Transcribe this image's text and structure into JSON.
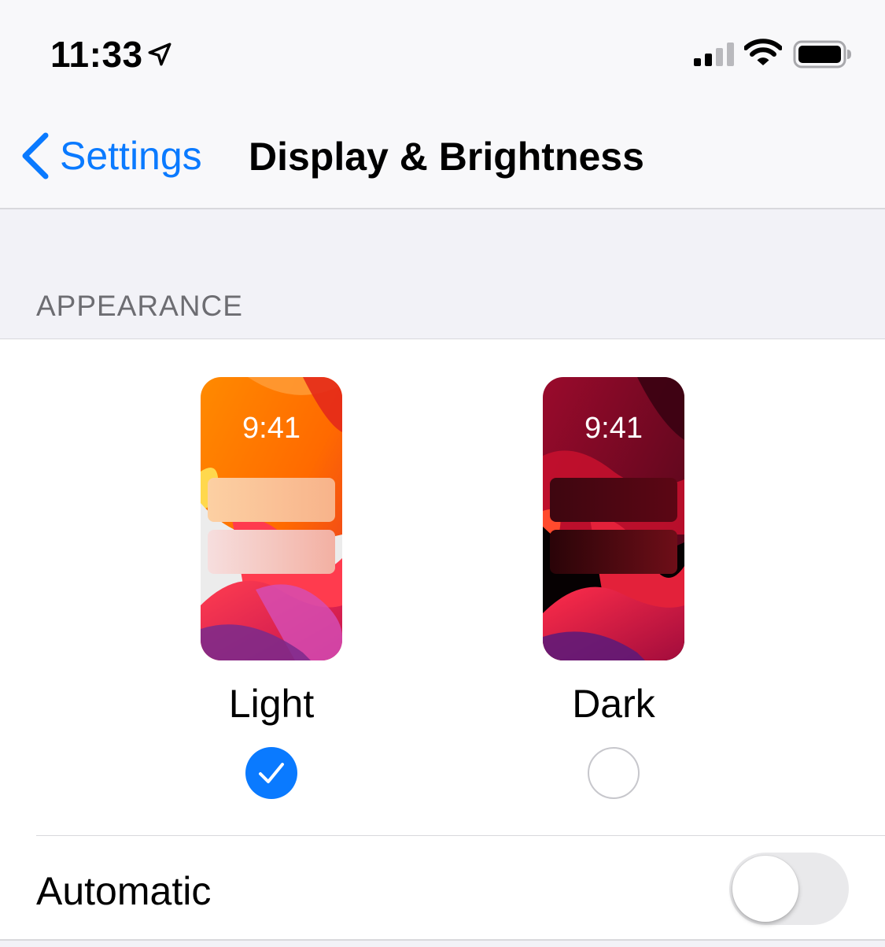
{
  "status_bar": {
    "time": "11:33",
    "icons": [
      "location-arrow-icon",
      "cellular-signal-icon",
      "wifi-icon",
      "battery-icon"
    ]
  },
  "nav": {
    "back_label": "Settings",
    "title": "Display & Brightness"
  },
  "appearance": {
    "section_header": "APPEARANCE",
    "options": [
      {
        "label": "Light",
        "preview_time": "9:41",
        "selected": true
      },
      {
        "label": "Dark",
        "preview_time": "9:41",
        "selected": false
      }
    ]
  },
  "automatic": {
    "label": "Automatic",
    "enabled": false
  },
  "colors": {
    "accent": "#0a7aff",
    "background": "#f2f2f7",
    "toggle_off": "#e9e9eb"
  }
}
